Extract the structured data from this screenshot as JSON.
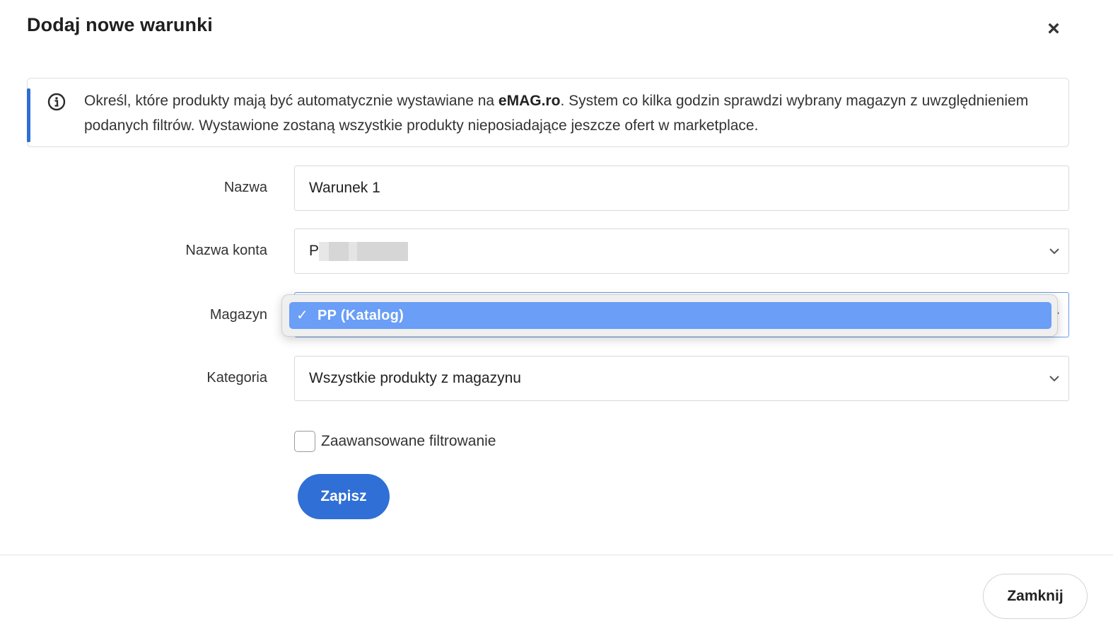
{
  "modal": {
    "title": "Dodaj nowe warunki",
    "close_glyph": "×"
  },
  "info": {
    "text_before": "Określ, które produkty mają być automatycznie wystawiane na ",
    "brand": "eMAG.ro",
    "text_after": ". System co kilka godzin sprawdzi wybrany magazyn z uwzględnieniem podanych filtrów. Wystawione zostaną wszystkie produkty nieposiadające jeszcze ofert w marketplace.",
    "accent_color": "#2f6ed6",
    "icon": "info-circle-icon"
  },
  "form": {
    "name": {
      "label": "Nazwa",
      "value": "Warunek 1"
    },
    "account": {
      "label": "Nazwa konta",
      "value": "P"
    },
    "warehouse": {
      "label": "Magazyn",
      "options": [
        {
          "label": "PP (Katalog)",
          "selected": true,
          "check": "✓"
        }
      ]
    },
    "category": {
      "label": "Kategoria",
      "value": "Wszystkie produkty z magazynu"
    },
    "advanced": {
      "label": "Zaawansowane filtrowanie",
      "checked": false
    },
    "save_label": "Zapisz"
  },
  "footer": {
    "close_label": "Zamknij"
  },
  "colors": {
    "primary": "#2f6fd6",
    "dropdown_highlight": "#6a9ef7",
    "border": "#d9d9d9"
  }
}
